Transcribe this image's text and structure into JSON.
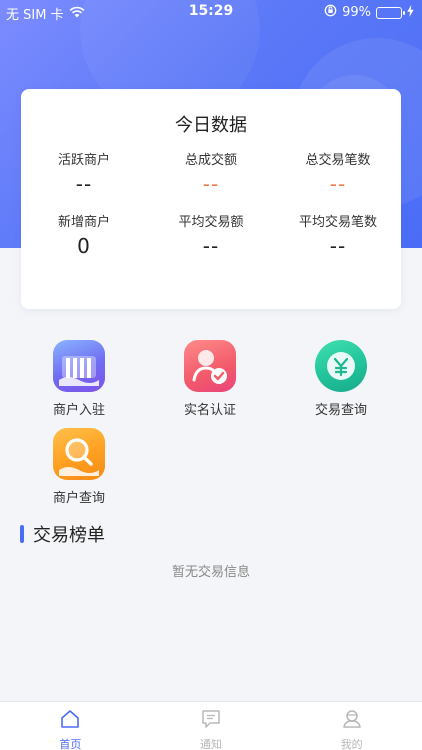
{
  "status_bar": {
    "carrier": "无 SIM 卡",
    "time": "15:29",
    "battery": "99%",
    "battery_level": 0.99
  },
  "today_card": {
    "title": "今日数据",
    "stats": [
      {
        "label": "活跃商户",
        "value": "--"
      },
      {
        "label": "总成交额",
        "value": "--"
      },
      {
        "label": "总交易笔数",
        "value": "--"
      },
      {
        "label": "新增商户",
        "value": "0"
      },
      {
        "label": "平均交易额",
        "value": "--"
      },
      {
        "label": "平均交易笔数",
        "value": "--"
      }
    ]
  },
  "menu": [
    {
      "label": "商户入驻",
      "icon": "merchant-onboarding-icon"
    },
    {
      "label": "实名认证",
      "icon": "real-name-verify-icon"
    },
    {
      "label": "交易查询",
      "icon": "transaction-query-icon"
    },
    {
      "label": "商户查询",
      "icon": "merchant-query-icon"
    }
  ],
  "ranking": {
    "title": "交易榜单",
    "empty_text": "暂无交易信息"
  },
  "tabbar": [
    {
      "label": "首页",
      "icon": "home-icon",
      "active": true
    },
    {
      "label": "通知",
      "icon": "notification-icon",
      "active": false
    },
    {
      "label": "我的",
      "icon": "profile-icon",
      "active": false
    }
  ],
  "colors": {
    "accent": "#4b6cf6",
    "highlight_value": "#f07a4a"
  }
}
